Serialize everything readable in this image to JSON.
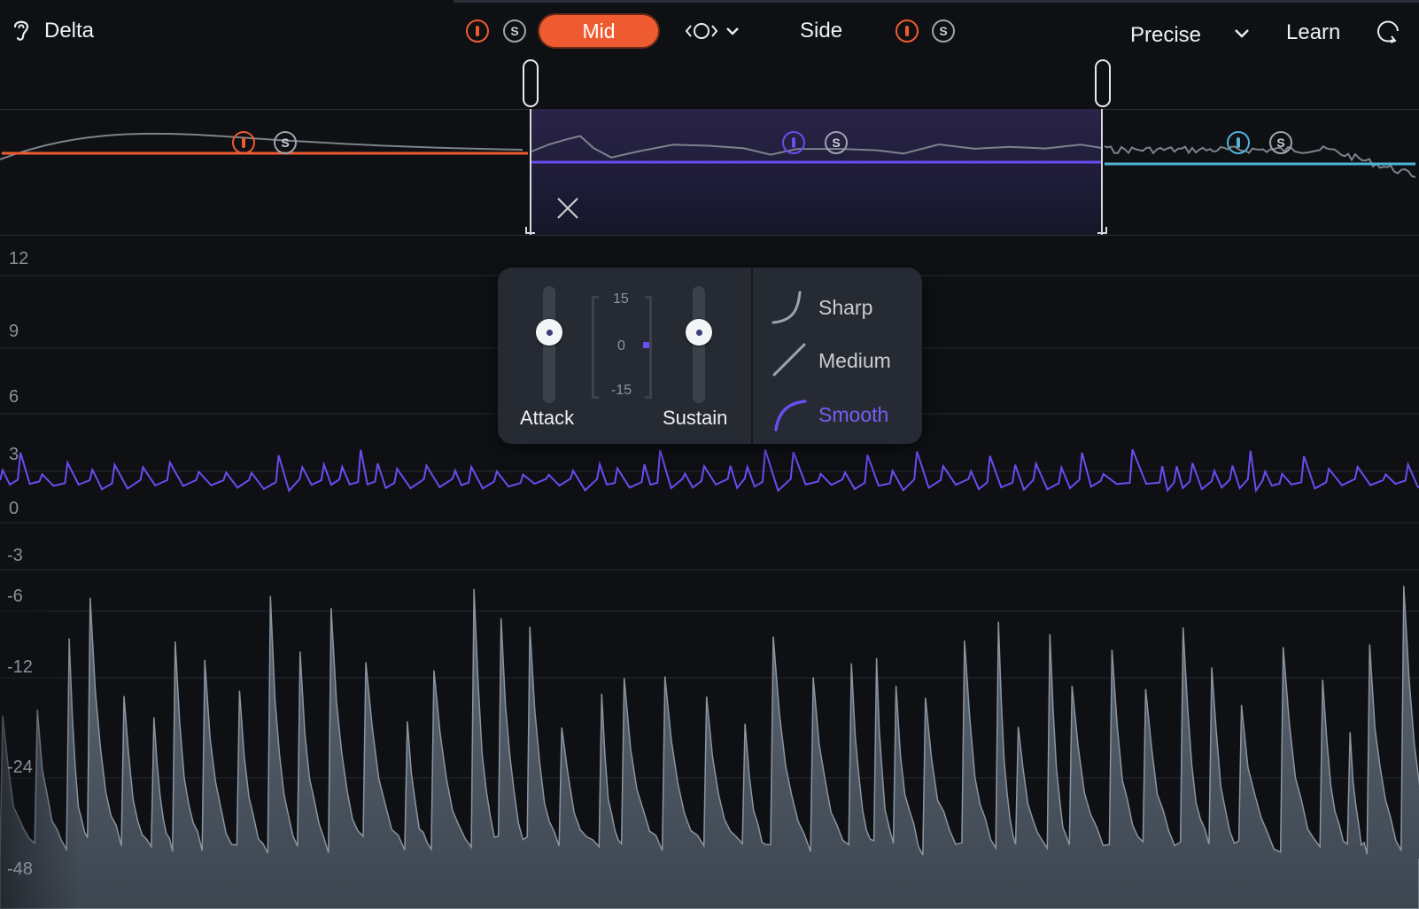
{
  "header": {
    "delta_label": "Delta",
    "mid_label": "Mid",
    "side_label": "Side",
    "mode_value": "Precise",
    "learn_label": "Learn",
    "solo_letter": "S"
  },
  "bands": [
    {
      "name": "low",
      "color": "#ef5b30",
      "solo_letter": "S"
    },
    {
      "name": "mid",
      "color": "#6a4cf0",
      "solo_letter": "S"
    },
    {
      "name": "high",
      "color": "#4fb4d8",
      "solo_letter": "S"
    }
  ],
  "db_scale": [
    "12",
    "9",
    "6",
    "3",
    "0",
    "-3",
    "-6",
    "-12",
    "-24",
    "-48"
  ],
  "panel": {
    "attack_label": "Attack",
    "sustain_label": "Sustain",
    "meter_ticks": [
      "15",
      "0",
      "-15"
    ],
    "curves": [
      {
        "label": "Sharp",
        "selected": false
      },
      {
        "label": "Medium",
        "selected": false
      },
      {
        "label": "Smooth",
        "selected": true
      }
    ]
  },
  "colors": {
    "accent": "#ef5b30",
    "purple": "#6a4cf0",
    "cyan": "#4fb4d8",
    "background": "#0e1014"
  }
}
